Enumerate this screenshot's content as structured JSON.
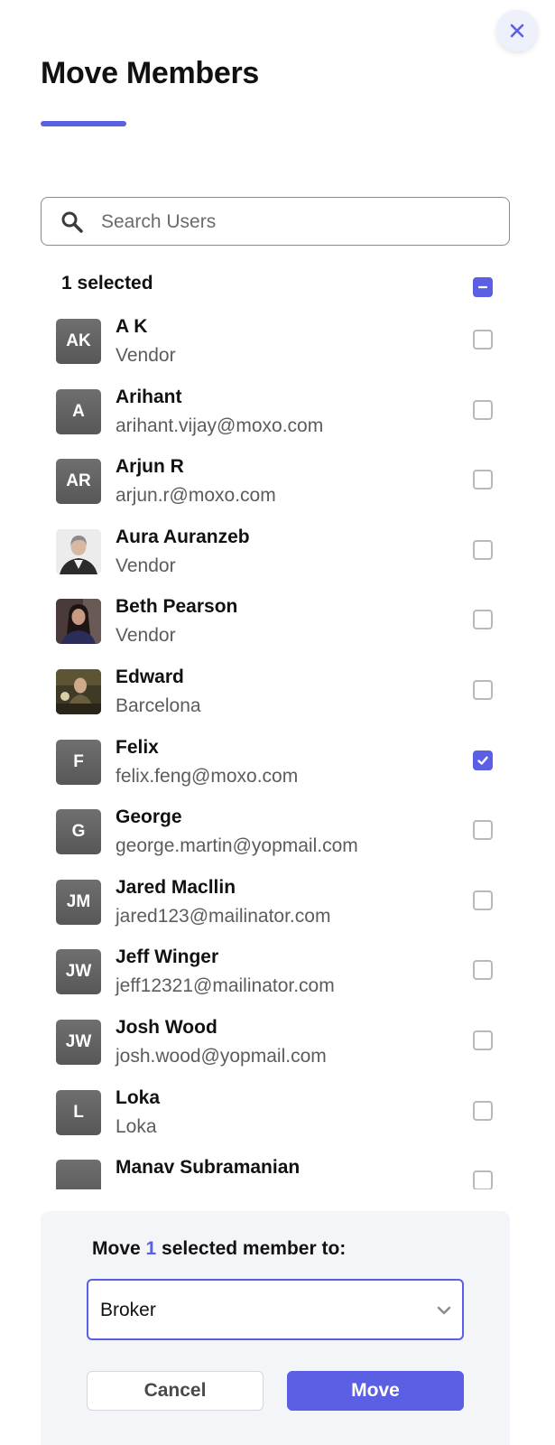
{
  "dialog": {
    "title": "Move Members",
    "accent_color": "#5b5fe3"
  },
  "search": {
    "placeholder": "Search Users",
    "value": ""
  },
  "selection": {
    "count_label": "1 selected",
    "select_all_state": "indeterminate"
  },
  "members": [
    {
      "initials": "AK",
      "name": "A K",
      "subtitle": "Vendor",
      "avatar": "initials",
      "checked": false
    },
    {
      "initials": "A",
      "name": "Arihant",
      "subtitle": "arihant.vijay@moxo.com",
      "avatar": "initials",
      "checked": false
    },
    {
      "initials": "AR",
      "name": "Arjun R",
      "subtitle": "arjun.r@moxo.com",
      "avatar": "initials",
      "checked": false
    },
    {
      "initials": "",
      "name": "Aura Auranzeb",
      "subtitle": "Vendor",
      "avatar": "photo-woman-gray-blazer",
      "checked": false
    },
    {
      "initials": "",
      "name": "Beth Pearson",
      "subtitle": "Vendor",
      "avatar": "photo-woman-dark-hair",
      "checked": false
    },
    {
      "initials": "",
      "name": "Edward",
      "subtitle": "Barcelona",
      "avatar": "photo-man-at-desk",
      "checked": false
    },
    {
      "initials": "F",
      "name": "Felix",
      "subtitle": "felix.feng@moxo.com",
      "avatar": "initials",
      "checked": true
    },
    {
      "initials": "G",
      "name": "George",
      "subtitle": "george.martin@yopmail.com",
      "avatar": "initials",
      "checked": false
    },
    {
      "initials": "JM",
      "name": "Jared Macllin",
      "subtitle": "jared123@mailinator.com",
      "avatar": "initials",
      "checked": false
    },
    {
      "initials": "JW",
      "name": "Jeff Winger",
      "subtitle": "jeff12321@mailinator.com",
      "avatar": "initials",
      "checked": false
    },
    {
      "initials": "JW",
      "name": "Josh Wood",
      "subtitle": "josh.wood@yopmail.com",
      "avatar": "initials",
      "checked": false
    },
    {
      "initials": "L",
      "name": "Loka",
      "subtitle": "Loka",
      "avatar": "initials",
      "checked": false
    },
    {
      "initials": "",
      "name": "Manav Subramanian",
      "subtitle": "",
      "avatar": "initials",
      "checked": false
    }
  ],
  "footer": {
    "move_label_prefix": "Move ",
    "move_count": "1",
    "move_label_suffix": " selected member to:",
    "destination_value": "Broker",
    "cancel_label": "Cancel",
    "move_label": "Move"
  },
  "icons": {
    "close": "close-icon",
    "search": "search-icon",
    "dropdown": "chevron-down-icon",
    "check": "checkmark-icon",
    "indeterminate": "minus-icon"
  }
}
